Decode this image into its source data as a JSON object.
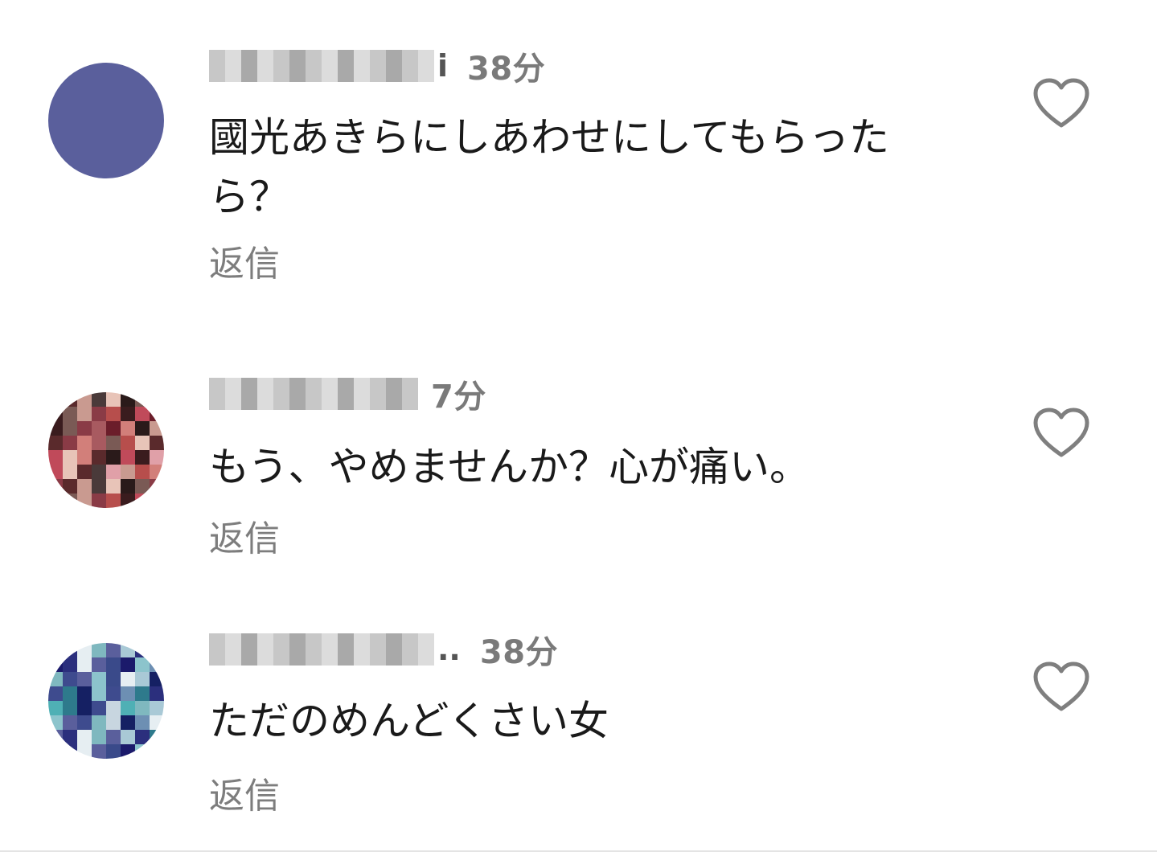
{
  "comments": [
    {
      "username_visible_suffix": "i",
      "time": "38分",
      "text": "國光あきらにしあわせにしてもらったら？",
      "reply_label": "返信",
      "avatar_icon": "pixelated-avatar-blue",
      "like_icon": "heart-outline-icon"
    },
    {
      "username_visible_suffix": "",
      "time": "7分",
      "text": "もう、やめませんか？心が痛い。",
      "reply_label": "返信",
      "avatar_icon": "pixelated-avatar-red",
      "like_icon": "heart-outline-icon"
    },
    {
      "username_visible_suffix": "..",
      "time": "38分",
      "text": "ただのめんどくさい女",
      "reply_label": "返信",
      "avatar_icon": "pixelated-avatar-blue",
      "like_icon": "heart-outline-icon"
    }
  ],
  "colors": {
    "text": "#1a1a1a",
    "meta": "#7a7a7a",
    "reply": "#7d7d7d",
    "icon_stroke": "#7f7f7f",
    "divider": "#e4e4e4"
  }
}
